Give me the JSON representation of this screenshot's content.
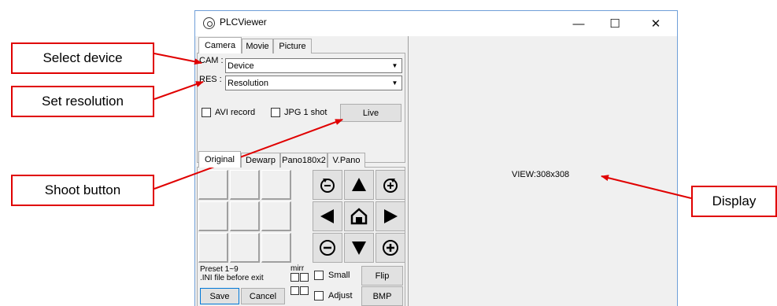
{
  "window": {
    "title": "PLCViewer",
    "min_glyph": "—",
    "max_glyph": "☐",
    "close_glyph": "✕"
  },
  "camera_tabs": [
    "Camera",
    "Movie",
    "Picture"
  ],
  "cam": {
    "label": "CAM :",
    "value": "Device"
  },
  "res": {
    "label": "RES :",
    "value": "Resolution"
  },
  "avi_record": {
    "label": "AVI record",
    "checked": false
  },
  "jpg_1shot": {
    "label": "JPG 1 shot",
    "checked": false
  },
  "live_button": "Live",
  "view_tabs": [
    "Original",
    "Dewarp",
    "Pano180x2",
    "V.Pano"
  ],
  "preset": {
    "line1": "Preset 1~9",
    "line2": ".INI file before exit"
  },
  "mirr_label": "mirr",
  "small": {
    "label": "Small",
    "checked": false
  },
  "adjust": {
    "label": "Adjust",
    "checked": false
  },
  "flip_button": "Flip",
  "bmp_button": "BMP",
  "save_button": "Save",
  "cancel_button": "Cancel",
  "display": {
    "view_text": "VIEW:308x308"
  },
  "annotations": {
    "select_device": "Select device",
    "set_resolution": "Set resolution",
    "shoot_button": "Shoot button",
    "display": "Display"
  },
  "ptz_icons": [
    "rotate-left-icon",
    "up-arrow-icon",
    "rotate-right-icon",
    "left-arrow-icon",
    "home-icon",
    "right-arrow-icon",
    "zoom-out-icon",
    "down-arrow-icon",
    "zoom-in-icon"
  ],
  "colors": {
    "annotation_red": "#e00000",
    "window_border": "#6f9fd8",
    "focus_blue": "#0078d7"
  }
}
